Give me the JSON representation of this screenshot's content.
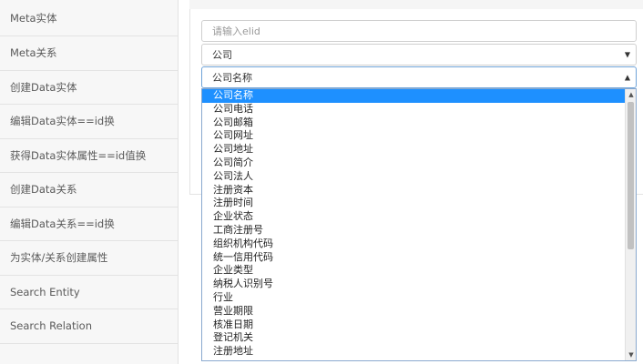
{
  "sidebar": {
    "items": [
      {
        "label": "Meta实体"
      },
      {
        "label": "Meta关系"
      },
      {
        "label": "创建Data实体"
      },
      {
        "label": "编辑Data实体==id换"
      },
      {
        "label": "获得Data实体属性==id值换"
      },
      {
        "label": "创建Data关系"
      },
      {
        "label": "编辑Data关系==id换"
      },
      {
        "label": "为实体/关系创建属性"
      },
      {
        "label": "Search Entity"
      },
      {
        "label": "Search Relation"
      }
    ]
  },
  "form": {
    "elid_placeholder": "请输入elid",
    "type_select_value": "公司",
    "field_select_value": "公司名称"
  },
  "dropdown": {
    "selected_index": 0,
    "scroll_fraction": 0.0,
    "options": [
      "公司名称",
      "公司电话",
      "公司邮箱",
      "公司网址",
      "公司地址",
      "公司简介",
      "公司法人",
      "注册资本",
      "注册时间",
      "企业状态",
      "工商注册号",
      "组织机构代码",
      "统一信用代码",
      "企业类型",
      "纳税人识别号",
      "行业",
      "营业期限",
      "核准日期",
      "登记机关",
      "注册地址"
    ]
  },
  "icons": {
    "select_arrow": "triangle-down-icon",
    "scroll_up": "triangle-up-icon",
    "scroll_down": "triangle-down-icon"
  },
  "colors": {
    "selected_option_bg": "#1e90ff",
    "focused_border": "#6fa3d8"
  }
}
